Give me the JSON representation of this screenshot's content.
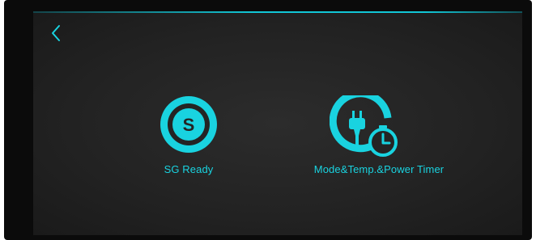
{
  "screen": {
    "accent_color": "#12c7d6",
    "background_color": "#262626"
  },
  "nav": {
    "back_icon": "chevron-left-icon"
  },
  "tiles": [
    {
      "label": "SG Ready",
      "icon": "sg-ready-icon"
    },
    {
      "label": "Mode&Temp.&Power Timer",
      "icon": "plug-timer-icon"
    }
  ]
}
